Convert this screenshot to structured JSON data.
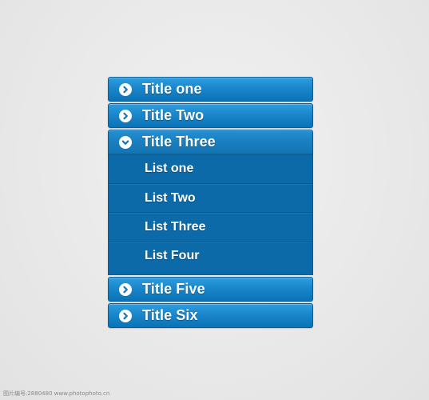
{
  "menu": {
    "items": [
      {
        "label": "Title one",
        "expanded": false
      },
      {
        "label": "Title Two",
        "expanded": false
      },
      {
        "label": "Title Three",
        "expanded": true,
        "children": [
          {
            "label": "List one"
          },
          {
            "label": "List Two"
          },
          {
            "label": "List Three"
          },
          {
            "label": "List Four"
          }
        ]
      },
      {
        "label": "Title Five",
        "expanded": false
      },
      {
        "label": "Title Six",
        "expanded": false
      }
    ]
  },
  "icons": {
    "collapsed": "chevron-right-icon",
    "expanded": "chevron-down-icon"
  },
  "colors": {
    "accent": "#1a86cb",
    "panel": "#0c6aa9",
    "background": "#e9e9e9"
  },
  "watermark": "图片编号:2880480  www.photophoto.cn"
}
